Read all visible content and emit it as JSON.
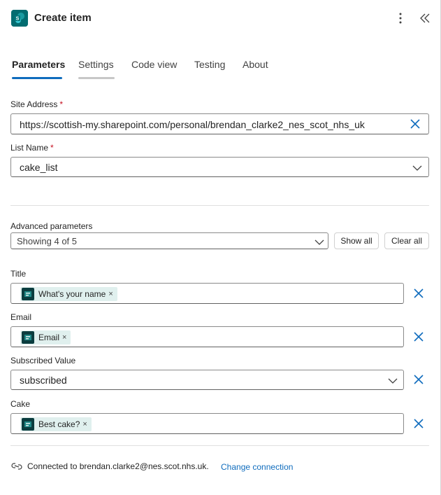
{
  "header": {
    "title": "Create item",
    "app_icon": "sharepoint-icon",
    "more_icon": "more-vertical-icon",
    "collapse_icon": "chevron-double-left-icon"
  },
  "tabs": [
    {
      "label": "Parameters",
      "active": true
    },
    {
      "label": "Settings",
      "active": false
    },
    {
      "label": "Code view",
      "active": false
    },
    {
      "label": "Testing",
      "active": false
    },
    {
      "label": "About",
      "active": false
    }
  ],
  "site_address": {
    "label": "Site Address",
    "required_mark": "*",
    "value": "https://scottish-my.sharepoint.com/personal/brendan_clarke2_nes_scot_nhs_uk"
  },
  "list_name": {
    "label": "List Name",
    "required_mark": "*",
    "value": "cake_list"
  },
  "advanced": {
    "label": "Advanced parameters",
    "dropdown_value": "Showing 4 of 5",
    "show_all_label": "Show all",
    "clear_all_label": "Clear all"
  },
  "params": {
    "title": {
      "label": "Title",
      "chip": "What's your name",
      "chip_close": "×"
    },
    "email": {
      "label": "Email",
      "chip": "Email",
      "chip_close": "×"
    },
    "subscribed": {
      "label": "Subscribed Value",
      "value": "subscribed"
    },
    "cake": {
      "label": "Cake",
      "chip": "Best cake?",
      "chip_close": "×"
    }
  },
  "footer": {
    "connected_text": "Connected to brendan.clarke2@nes.scot.nhs.uk.",
    "change_link": "Change connection",
    "icon": "connection-icon"
  },
  "colors": {
    "accent": "#0f6cbd",
    "settings_underline": "#c7c7c7",
    "chip_bg": "#e0f0ee",
    "app_icon_bg": "#036c70",
    "required": "#c50f1f"
  }
}
